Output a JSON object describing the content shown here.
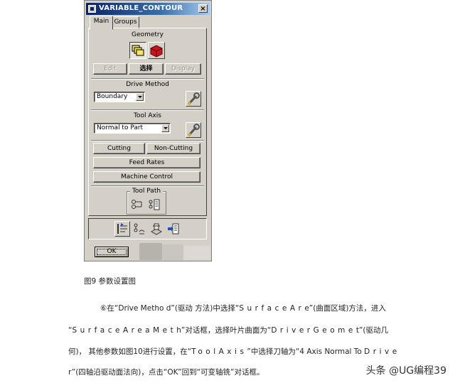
{
  "dialog": {
    "title": "VARIABLE_CONTOUR",
    "close_glyph": "×",
    "tabs": [
      {
        "label": "Main",
        "active": true
      },
      {
        "label": "Groups",
        "active": false
      }
    ],
    "geometry": {
      "heading": "Geometry",
      "icons": [
        "part-geometry-icon",
        "check-geometry-icon"
      ],
      "buttons": {
        "edit": "Edit",
        "select": "选择",
        "display": "Display"
      }
    },
    "drive_method": {
      "heading": "Drive Method",
      "value": "Boundary",
      "edit_icon": "wrench-icon"
    },
    "tool_axis": {
      "heading": "Tool Axis",
      "value": "Normal to Part",
      "edit_icon": "wrench-icon"
    },
    "buttons": {
      "cutting": "Cutting",
      "non_cutting": "Non-Cutting",
      "feed_rates": "Feed Rates",
      "machine_control": "Machine Control"
    },
    "tool_path": {
      "heading": "Tool Path",
      "icons": [
        "generate-path-icon",
        "replay-path-icon"
      ]
    },
    "bottom_icons": [
      "list-icon",
      "verify-icon",
      "animate-icon",
      "output-icon"
    ],
    "ok": "OK"
  },
  "document": {
    "caption": "图9 参数设置图",
    "paragraph": {
      "l1_a": "⑥在“Drive Metho d”(驱动 方法)中选择“",
      "l1_b": "SurfaceAr",
      "l1_c": "e”(曲面区域)方法，进入",
      "l2_a": "“",
      "l2_b": "SurfaceAreaMet",
      "l2_c": "h”对话框，选择叶片曲面为“",
      "l2_d": "DriverGeome",
      "l2_e": "t”(驱动几",
      "l3_a": "何)， 其他参数如图10进行设置，在“",
      "l3_b": "ToolAxis",
      "l3_c": "”中选择刀轴为“4 Axis Normal To ",
      "l3_d": "Drive",
      "l4": "r”(四轴沿驱动面法向)，点击“OK”回到“可变轴铣”对话框。"
    }
  },
  "watermark": "头条 @UG编程39",
  "colors": {
    "dialog_bg": "#d4d0c8",
    "title_dark": "#0a246a",
    "title_light": "#a6caf0"
  }
}
